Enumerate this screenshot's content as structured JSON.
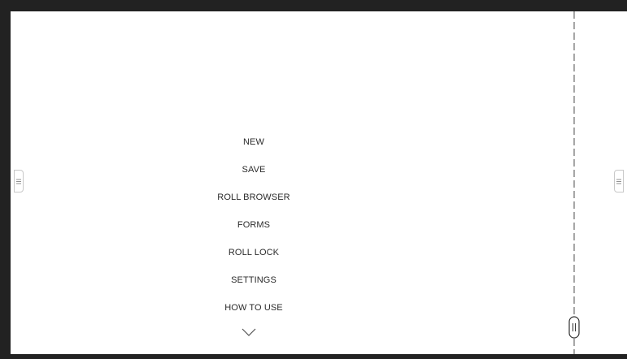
{
  "menu": {
    "items": [
      {
        "id": "new",
        "label": "NEW"
      },
      {
        "id": "save",
        "label": "SAVE"
      },
      {
        "id": "roll-browser",
        "label": "ROLL BROWSER"
      },
      {
        "id": "forms",
        "label": "FORMS"
      },
      {
        "id": "roll-lock",
        "label": "ROLL LOCK"
      },
      {
        "id": "settings",
        "label": "SETTINGS"
      },
      {
        "id": "how-to-use",
        "label": "HOW TO USE"
      }
    ],
    "more_icon": "chevron-down-icon"
  },
  "side_handles": {
    "left_icon": "menu-lines-icon",
    "right_icon": "menu-lines-icon"
  },
  "cut_line": {
    "handle_icon": "vertical-grip-icon"
  },
  "colors": {
    "frame": "#222222",
    "screen": "#ffffff",
    "text": "#2b2b2b",
    "line": "#8a8a8a"
  }
}
